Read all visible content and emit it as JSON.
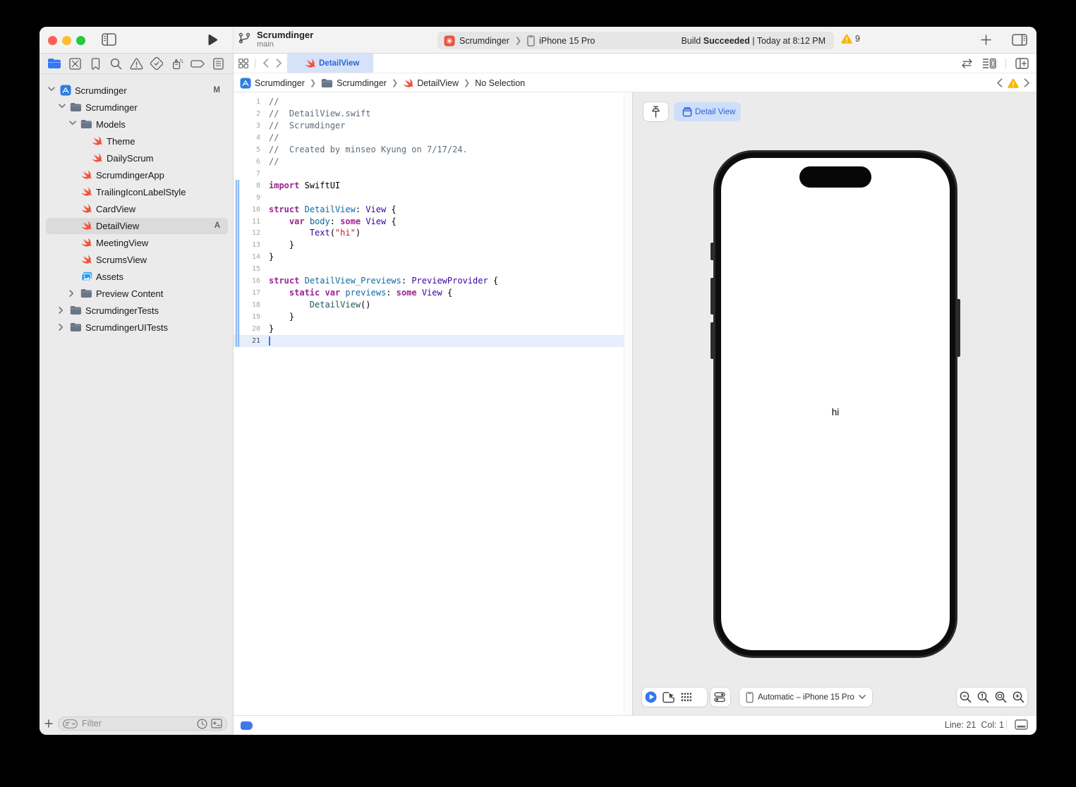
{
  "window": {
    "traffic_lights": {
      "close": "#ff5f57",
      "minimize": "#febc2e",
      "zoom": "#28c840"
    },
    "toolbar": {
      "project_name": "Scrumdinger",
      "branch_name": "main",
      "scheme_name": "Scrumdinger",
      "run_destination": "iPhone 15 Pro",
      "status_build": "Build",
      "status_result": "Succeeded",
      "status_detail": " | Today at 8:12 PM",
      "warning_count": "9"
    }
  },
  "navigator": {
    "icons": [
      {
        "name": "project-navigator-icon",
        "icon": "folder-nav",
        "active": true
      },
      {
        "name": "source-control-navigator-icon",
        "icon": "square-x",
        "active": false
      },
      {
        "name": "bookmarks-navigator-icon",
        "icon": "bookmark",
        "active": false
      },
      {
        "name": "find-navigator-icon",
        "icon": "magnifier",
        "active": false
      },
      {
        "name": "issues-navigator-icon",
        "icon": "warn-outline",
        "active": false
      },
      {
        "name": "tests-navigator-icon",
        "icon": "diamond-check",
        "active": false
      },
      {
        "name": "debug-navigator-icon",
        "icon": "spray",
        "active": false
      },
      {
        "name": "breakpoints-navigator-icon",
        "icon": "capsule",
        "active": false
      },
      {
        "name": "reports-navigator-icon",
        "icon": "doc-list",
        "active": false
      }
    ],
    "tree": [
      {
        "label": "Scrumdinger",
        "icon": "app",
        "level": 0,
        "chevron": "down",
        "badge": "M",
        "selected": false
      },
      {
        "label": "Scrumdinger",
        "icon": "folder",
        "level": 1,
        "chevron": "down",
        "badge": "",
        "selected": false
      },
      {
        "label": "Models",
        "icon": "folder",
        "level": 2,
        "chevron": "down",
        "badge": "",
        "selected": false
      },
      {
        "label": "Theme",
        "icon": "swift",
        "level": 3,
        "chevron": "none",
        "badge": "",
        "selected": false
      },
      {
        "label": "DailyScrum",
        "icon": "swift",
        "level": 3,
        "chevron": "none",
        "badge": "",
        "selected": false
      },
      {
        "label": "ScrumdingerApp",
        "icon": "swift",
        "level": 2,
        "chevron": "none",
        "badge": "",
        "selected": false
      },
      {
        "label": "TrailingIconLabelStyle",
        "icon": "swift",
        "level": 2,
        "chevron": "none",
        "badge": "",
        "selected": false
      },
      {
        "label": "CardView",
        "icon": "swift",
        "level": 2,
        "chevron": "none",
        "badge": "",
        "selected": false
      },
      {
        "label": "DetailView",
        "icon": "swift",
        "level": 2,
        "chevron": "none",
        "badge": "A",
        "selected": true
      },
      {
        "label": "MeetingView",
        "icon": "swift",
        "level": 2,
        "chevron": "none",
        "badge": "",
        "selected": false
      },
      {
        "label": "ScrumsView",
        "icon": "swift",
        "level": 2,
        "chevron": "none",
        "badge": "",
        "selected": false
      },
      {
        "label": "Assets",
        "icon": "assets",
        "level": 2,
        "chevron": "none",
        "badge": "",
        "selected": false
      },
      {
        "label": "Preview Content",
        "icon": "folder",
        "level": 2,
        "chevron": "right",
        "badge": "",
        "selected": false
      },
      {
        "label": "ScrumdingerTests",
        "icon": "folder",
        "level": 1,
        "chevron": "right",
        "badge": "",
        "selected": false
      },
      {
        "label": "ScrumdingerUITests",
        "icon": "folder",
        "level": 1,
        "chevron": "right",
        "badge": "",
        "selected": false
      }
    ],
    "filter_placeholder": "Filter"
  },
  "tabbar": {
    "tabs": [
      {
        "label": "DetailView",
        "icon": "swift",
        "active": true
      }
    ]
  },
  "jumpbar": {
    "segments": [
      {
        "label": "Scrumdinger",
        "icon": "app"
      },
      {
        "label": "Scrumdinger",
        "icon": "folder"
      },
      {
        "label": "DetailView",
        "icon": "swift"
      },
      {
        "label": "No Selection",
        "icon": ""
      }
    ]
  },
  "editor": {
    "cursor_line": 21,
    "lines": [
      {
        "n": 1,
        "changed": false,
        "tokens": [
          [
            "cm",
            "//"
          ]
        ]
      },
      {
        "n": 2,
        "changed": false,
        "tokens": [
          [
            "cm",
            "//  DetailView.swift"
          ]
        ]
      },
      {
        "n": 3,
        "changed": false,
        "tokens": [
          [
            "cm",
            "//  Scrumdinger"
          ]
        ]
      },
      {
        "n": 4,
        "changed": false,
        "tokens": [
          [
            "cm",
            "//"
          ]
        ]
      },
      {
        "n": 5,
        "changed": false,
        "tokens": [
          [
            "cm",
            "//  Created by minseo Kyung on 7/17/24."
          ]
        ]
      },
      {
        "n": 6,
        "changed": false,
        "tokens": [
          [
            "cm",
            "//"
          ]
        ]
      },
      {
        "n": 7,
        "changed": false,
        "tokens": []
      },
      {
        "n": 8,
        "changed": true,
        "tokens": [
          [
            "kw",
            "import"
          ],
          [
            "pl",
            " SwiftUI"
          ]
        ]
      },
      {
        "n": 9,
        "changed": true,
        "tokens": []
      },
      {
        "n": 10,
        "changed": true,
        "tokens": [
          [
            "kw",
            "struct"
          ],
          [
            "pl",
            " "
          ],
          [
            "decl",
            "DetailView"
          ],
          [
            "pl",
            ": "
          ],
          [
            "type",
            "View"
          ],
          [
            "pl",
            " {"
          ]
        ]
      },
      {
        "n": 11,
        "changed": true,
        "tokens": [
          [
            "pl",
            "    "
          ],
          [
            "kw",
            "var"
          ],
          [
            "pl",
            " "
          ],
          [
            "decl",
            "body"
          ],
          [
            "pl",
            ": "
          ],
          [
            "kw",
            "some"
          ],
          [
            "pl",
            " "
          ],
          [
            "type",
            "View"
          ],
          [
            "pl",
            " {"
          ]
        ]
      },
      {
        "n": 12,
        "changed": true,
        "tokens": [
          [
            "pl",
            "        "
          ],
          [
            "type",
            "Text"
          ],
          [
            "pl",
            "("
          ],
          [
            "str",
            "\"hi\""
          ],
          [
            "pl",
            ")"
          ]
        ]
      },
      {
        "n": 13,
        "changed": true,
        "tokens": [
          [
            "pl",
            "    }"
          ]
        ]
      },
      {
        "n": 14,
        "changed": true,
        "tokens": [
          [
            "pl",
            "}"
          ]
        ]
      },
      {
        "n": 15,
        "changed": true,
        "tokens": []
      },
      {
        "n": 16,
        "changed": true,
        "tokens": [
          [
            "kw",
            "struct"
          ],
          [
            "pl",
            " "
          ],
          [
            "decl",
            "DetailView_Previews"
          ],
          [
            "pl",
            ": "
          ],
          [
            "type",
            "PreviewProvider"
          ],
          [
            "pl",
            " {"
          ]
        ]
      },
      {
        "n": 17,
        "changed": true,
        "tokens": [
          [
            "pl",
            "    "
          ],
          [
            "kw",
            "static"
          ],
          [
            "pl",
            " "
          ],
          [
            "kw",
            "var"
          ],
          [
            "pl",
            " "
          ],
          [
            "decl",
            "previews"
          ],
          [
            "pl",
            ": "
          ],
          [
            "kw",
            "some"
          ],
          [
            "pl",
            " "
          ],
          [
            "type",
            "View"
          ],
          [
            "pl",
            " {"
          ]
        ]
      },
      {
        "n": 18,
        "changed": true,
        "tokens": [
          [
            "pl",
            "        "
          ],
          [
            "proj",
            "DetailView"
          ],
          [
            "pl",
            "()"
          ]
        ]
      },
      {
        "n": 19,
        "changed": true,
        "tokens": [
          [
            "pl",
            "    }"
          ]
        ]
      },
      {
        "n": 20,
        "changed": true,
        "tokens": [
          [
            "pl",
            "}"
          ]
        ]
      },
      {
        "n": 21,
        "changed": true,
        "tokens": []
      }
    ]
  },
  "canvas": {
    "preview_tab_label": "Detail View",
    "screen_text": "hi",
    "device_selector": "Automatic – iPhone 15 Pro"
  },
  "statusbar": {
    "line_col": "Line: 21  Col: 1"
  },
  "colors": {
    "accent_blue": "#2a66d6",
    "warning_yellow": "#f7b500",
    "swift_orange": "#f05138"
  }
}
